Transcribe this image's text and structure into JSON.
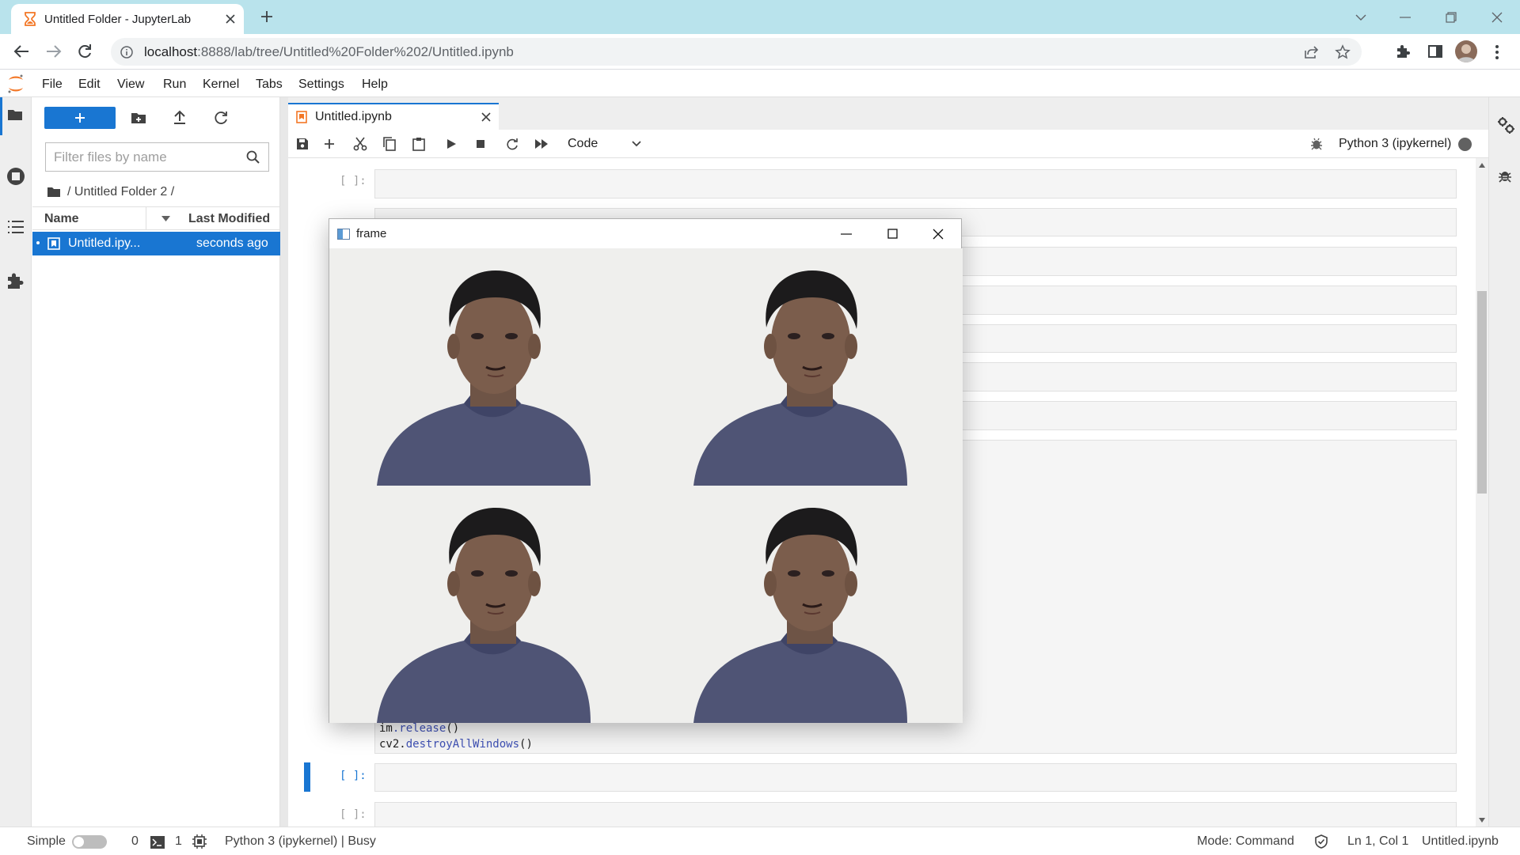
{
  "browser": {
    "tab_title": "Untitled Folder - JupyterLab",
    "url_host": "localhost",
    "url_path": ":8888/lab/tree/Untitled%20Folder%202/Untitled.ipynb"
  },
  "menu": [
    "File",
    "Edit",
    "View",
    "Run",
    "Kernel",
    "Tabs",
    "Settings",
    "Help"
  ],
  "filebrowser": {
    "filter_placeholder": "Filter files by name",
    "breadcrumb": "/ Untitled Folder 2 /",
    "col_name": "Name",
    "col_modified": "Last Modified",
    "files": [
      {
        "name": "Untitled.ipy...",
        "modified": "seconds ago"
      }
    ]
  },
  "notebook": {
    "tab_title": "Untitled.ipynb",
    "cell_type": "Code",
    "kernel_name": "Python 3 (ipykernel)",
    "prompt_empty": "[ ]:",
    "code_line_1_obj": "im",
    "code_line_1_method": ".release",
    "code_line_1_paren": "()",
    "code_line_2_obj": "cv2",
    "code_line_2_dot": ".",
    "code_line_2_method": "destroyAllWindows",
    "code_line_2_paren": "()"
  },
  "cv_window": {
    "title": "frame"
  },
  "statusbar": {
    "mode_toggle_label": "Simple",
    "terminals_count": "0",
    "kernels_count": "1",
    "kernel_status": "Python 3 (ipykernel) | Busy",
    "mode": "Mode: Command",
    "cursor": "Ln 1, Col 1",
    "filename": "Untitled.ipynb"
  },
  "colors": {
    "accent": "#1976d2",
    "browser_bar": "#b9e3ec",
    "shirt": "#4f5475",
    "hair": "#1c1b1c"
  }
}
